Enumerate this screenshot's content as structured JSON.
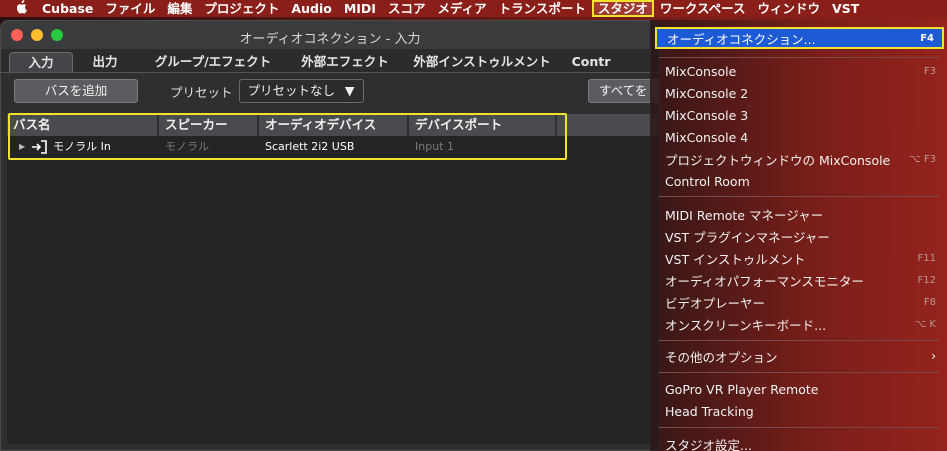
{
  "menubar": {
    "apple": "",
    "items": [
      "Cubase",
      "ファイル",
      "編集",
      "プロジェクト",
      "Audio",
      "MIDI",
      "スコア",
      "メディア",
      "トランスポート",
      "スタジオ",
      "ワークスペース",
      "ウィンドウ",
      "VST"
    ]
  },
  "window": {
    "title": "オーディオコネクション - 入力",
    "tabs": [
      "入力",
      "出力",
      "グループ/エフェクト",
      "外部エフェクト",
      "外部インストゥルメント",
      "Contr"
    ],
    "add_bus_button": "バスを追加",
    "preset_label": "プリセット",
    "preset_value": "プリセットなし",
    "preset_arrow": "▼",
    "all_button": "すべてを",
    "table": {
      "headers": [
        "バス名",
        "スピーカー",
        "オーディオデバイス",
        "デバイスポート"
      ],
      "rows": [
        {
          "expand": "▶",
          "name": "モノラル In",
          "speaker": "モノラル",
          "device": "Scarlett 2i2 USB",
          "port": "Input 1"
        }
      ]
    }
  },
  "studio_menu": {
    "items": [
      {
        "label": "オーディオコネクション...",
        "shortcut": "F4"
      },
      {
        "label": "MixConsole",
        "shortcut": "F3"
      },
      {
        "label": "MixConsole 2",
        "shortcut": ""
      },
      {
        "label": "MixConsole 3",
        "shortcut": ""
      },
      {
        "label": "MixConsole 4",
        "shortcut": ""
      },
      {
        "label": "プロジェクトウィンドウの MixConsole",
        "shortcut": "⌥ F3"
      },
      {
        "label": "Control Room",
        "shortcut": ""
      },
      {
        "label": "MIDI Remote マネージャー",
        "shortcut": ""
      },
      {
        "label": "VST プラグインマネージャー",
        "shortcut": ""
      },
      {
        "label": "VST インストゥルメント",
        "shortcut": "F11"
      },
      {
        "label": "オーディオパフォーマンスモニター",
        "shortcut": "F12"
      },
      {
        "label": "ビデオプレーヤー",
        "shortcut": "F8"
      },
      {
        "label": "オンスクリーンキーボード...",
        "shortcut": "⌥ K"
      },
      {
        "label": "その他のオプション",
        "shortcut": "›"
      },
      {
        "label": "GoPro VR Player Remote",
        "shortcut": ""
      },
      {
        "label": "Head Tracking",
        "shortcut": ""
      },
      {
        "label": "スタジオ設定...",
        "shortcut": ""
      }
    ]
  },
  "colors": {
    "highlight_outline": "#f2e22f",
    "selected_item": "#1d5bd6",
    "menubar_bg": "#8a1f1a"
  }
}
